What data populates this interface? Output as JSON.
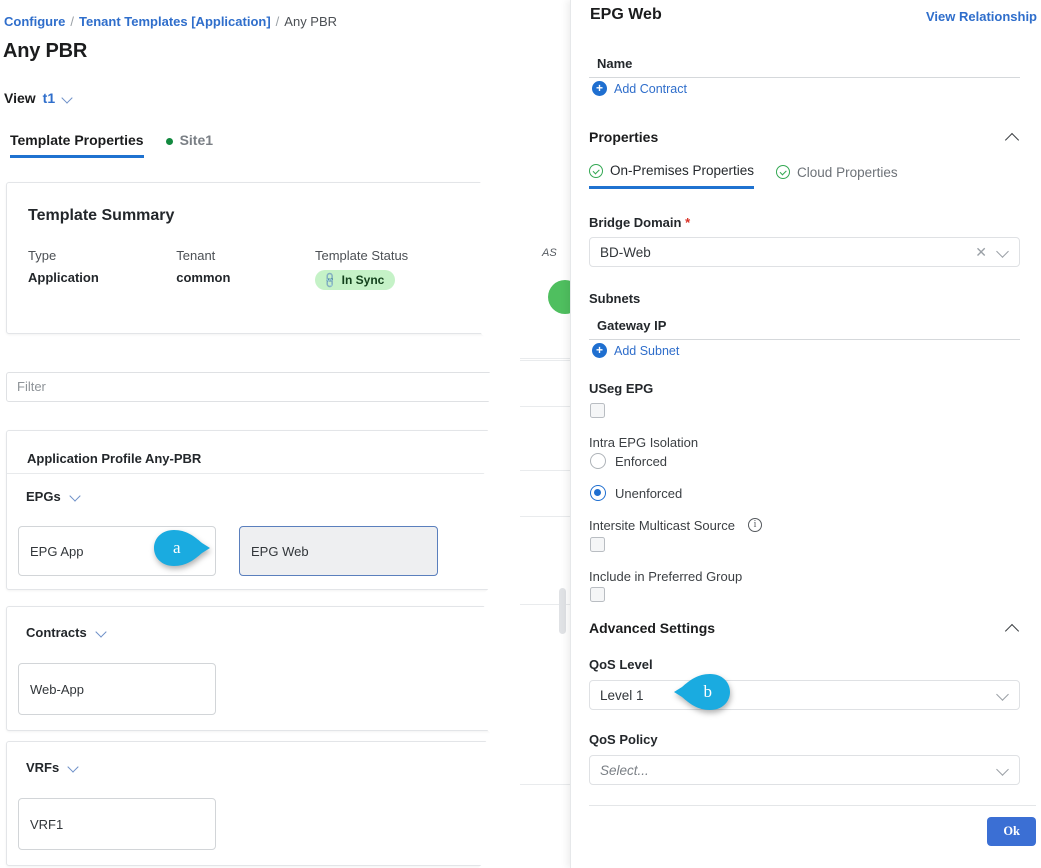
{
  "left": {
    "breadcrumb": {
      "items": [
        "Configure",
        "Tenant Templates [Application]",
        "Any PBR"
      ],
      "separator": "/"
    },
    "page_title": "Any PBR",
    "view": {
      "label": "View",
      "value": "t1",
      "chevron_icon": "chevron-down-icon"
    },
    "tabs": [
      {
        "label": "Template Properties",
        "active": true,
        "dot": false
      },
      {
        "label": "Site1",
        "active": false,
        "dot": true,
        "dot_color": "#12893f"
      }
    ],
    "summary": {
      "title": "Template Summary",
      "fields": [
        {
          "label": "Type",
          "value": "Application"
        },
        {
          "label": "Tenant",
          "value": "common"
        },
        {
          "label": "Template Status",
          "value": "In Sync",
          "badge": true,
          "badge_bg": "#c5f2c7",
          "badge_icon": "link-icon"
        }
      ]
    },
    "filter": {
      "placeholder": "Filter",
      "value": ""
    },
    "app_profile": {
      "title": "Application Profile Any-PBR",
      "epgs": {
        "label": "EPGs",
        "chevron_icon": "chevron-down-icon",
        "items": [
          {
            "name": "EPG App",
            "selected": false
          },
          {
            "name": "EPG Web",
            "selected": true
          }
        ]
      }
    },
    "contracts": {
      "label": "Contracts",
      "chevron_icon": "chevron-down-icon",
      "items": [
        {
          "name": "Web-App"
        }
      ]
    },
    "vrfs": {
      "label": "VRFs",
      "chevron_icon": "chevron-down-icon",
      "items": [
        {
          "name": "VRF1"
        }
      ]
    }
  },
  "ghost": {
    "text": "AS"
  },
  "right": {
    "title": "EPG Web",
    "view_relationship": "View Relationship",
    "contracts": {
      "column_header": "Name",
      "add_label": "Add Contract",
      "rows": []
    },
    "properties": {
      "section_title": "Properties",
      "collapse_icon": "chevron-up-icon",
      "tabs": [
        {
          "label": "On-Premises Properties",
          "active": true,
          "icon": "check-circle-icon"
        },
        {
          "label": "Cloud Properties",
          "active": false,
          "icon": "check-circle-icon"
        }
      ],
      "bridge_domain": {
        "label": "Bridge Domain",
        "required": true,
        "value": "BD-Web",
        "clear_icon": "close-icon",
        "chevron_icon": "chevron-down-icon"
      },
      "subnets": {
        "label": "Subnets",
        "column_header": "Gateway IP",
        "add_label": "Add Subnet",
        "rows": []
      },
      "useg_epg": {
        "label": "USeg EPG",
        "checked": false
      },
      "intra_epg_isolation": {
        "label": "Intra EPG Isolation",
        "options": [
          {
            "label": "Enforced",
            "selected": false
          },
          {
            "label": "Unenforced",
            "selected": true
          }
        ]
      },
      "intersite_multicast_source": {
        "label": "Intersite Multicast Source",
        "checked": false,
        "info_icon": "info-icon"
      },
      "include_preferred_group": {
        "label": "Include in Preferred Group",
        "checked": false
      }
    },
    "advanced": {
      "section_title": "Advanced Settings",
      "collapse_icon": "chevron-up-icon",
      "qos_level": {
        "label": "QoS Level",
        "value": "Level 1",
        "chevron_icon": "chevron-down-icon"
      },
      "qos_policy": {
        "label": "QoS Policy",
        "value": "",
        "placeholder": "Select...",
        "chevron_icon": "chevron-down-icon"
      }
    },
    "ok_button": "Ok"
  },
  "callouts": [
    {
      "letter": "a",
      "color": "#1aabe0",
      "direction": "right"
    },
    {
      "letter": "b",
      "color": "#1aabe0",
      "direction": "left"
    }
  ]
}
